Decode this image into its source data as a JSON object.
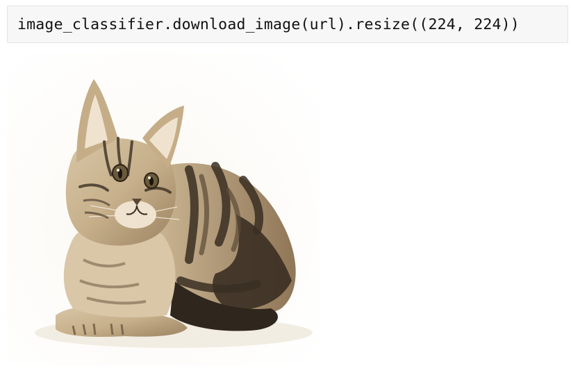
{
  "cell": {
    "code": "image_classifier.download_image(url).resize((224, 224))"
  },
  "output": {
    "image_icon": "kitten-photo",
    "image_alt": "kitten photo"
  },
  "colors": {
    "cell_background": "#f7f7f7",
    "cell_border": "#e3e3e3",
    "fur_light": "#d9c7a8",
    "fur_mid": "#a58b66",
    "fur_dark": "#2f271d"
  }
}
